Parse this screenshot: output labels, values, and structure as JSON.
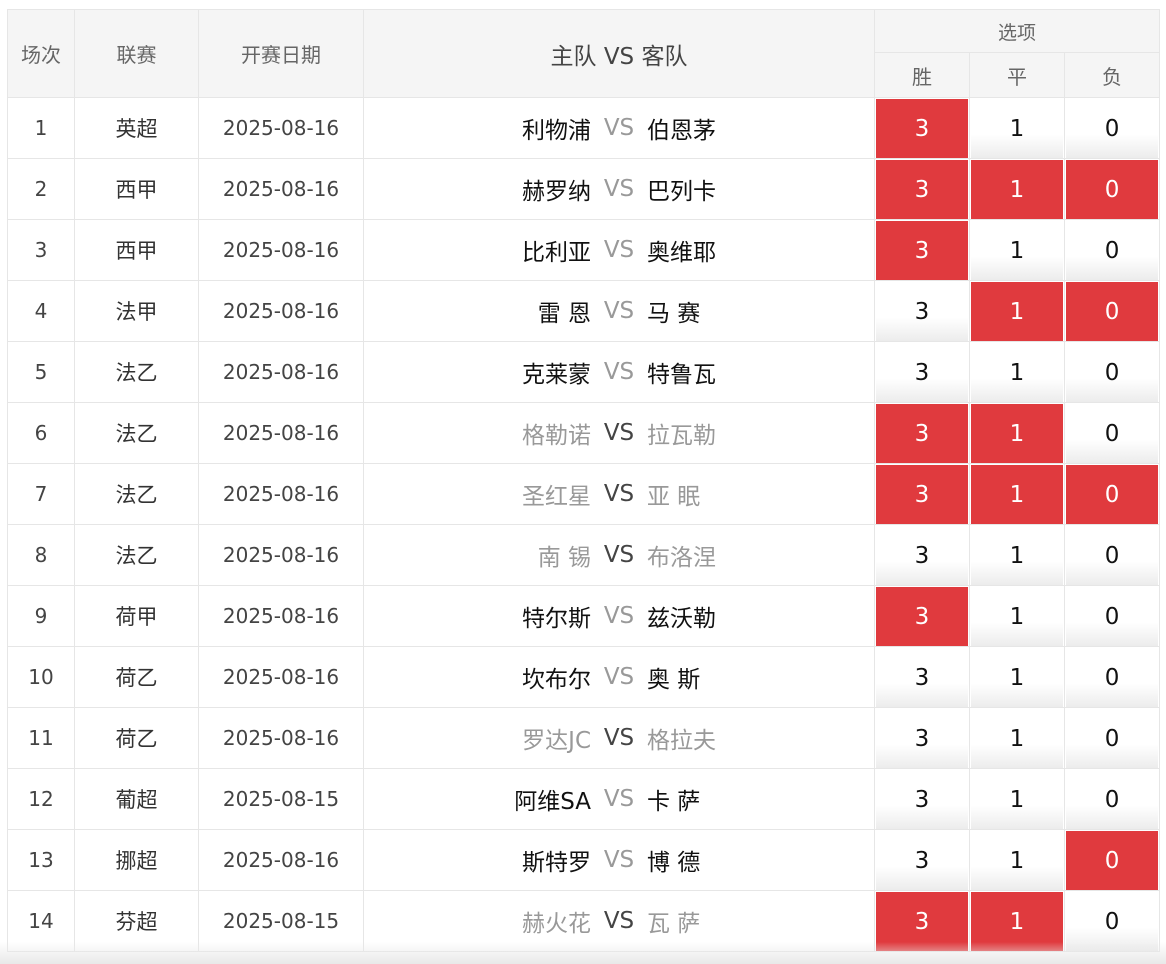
{
  "header": {
    "col_index": "场次",
    "col_league": "联赛",
    "col_date": "开赛日期",
    "col_match": "主队 VS 客队",
    "col_options": "选项",
    "opt_win": "胜",
    "opt_draw": "平",
    "opt_lose": "负"
  },
  "vs_label": "VS",
  "rows": [
    {
      "idx": "1",
      "league": "英超",
      "date": "2025-08-16",
      "home": "利物浦",
      "away": "伯恩茅",
      "grey": false,
      "w": "3",
      "d": "1",
      "l": "0",
      "sel": [
        true,
        false,
        false
      ]
    },
    {
      "idx": "2",
      "league": "西甲",
      "date": "2025-08-16",
      "home": "赫罗纳",
      "away": "巴列卡",
      "grey": false,
      "w": "3",
      "d": "1",
      "l": "0",
      "sel": [
        true,
        true,
        true
      ]
    },
    {
      "idx": "3",
      "league": "西甲",
      "date": "2025-08-16",
      "home": "比利亚",
      "away": "奥维耶",
      "grey": false,
      "w": "3",
      "d": "1",
      "l": "0",
      "sel": [
        true,
        false,
        false
      ]
    },
    {
      "idx": "4",
      "league": "法甲",
      "date": "2025-08-16",
      "home": "雷 恩",
      "away": "马 赛",
      "grey": false,
      "w": "3",
      "d": "1",
      "l": "0",
      "sel": [
        false,
        true,
        true
      ]
    },
    {
      "idx": "5",
      "league": "法乙",
      "date": "2025-08-16",
      "home": "克莱蒙",
      "away": "特鲁瓦",
      "grey": false,
      "w": "3",
      "d": "1",
      "l": "0",
      "sel": [
        false,
        false,
        false
      ]
    },
    {
      "idx": "6",
      "league": "法乙",
      "date": "2025-08-16",
      "home": "格勒诺",
      "away": "拉瓦勒",
      "grey": true,
      "w": "3",
      "d": "1",
      "l": "0",
      "sel": [
        true,
        true,
        false
      ]
    },
    {
      "idx": "7",
      "league": "法乙",
      "date": "2025-08-16",
      "home": "圣红星",
      "away": "亚 眠",
      "grey": true,
      "w": "3",
      "d": "1",
      "l": "0",
      "sel": [
        true,
        true,
        true
      ]
    },
    {
      "idx": "8",
      "league": "法乙",
      "date": "2025-08-16",
      "home": "南 锡",
      "away": "布洛涅",
      "grey": true,
      "w": "3",
      "d": "1",
      "l": "0",
      "sel": [
        false,
        false,
        false
      ]
    },
    {
      "idx": "9",
      "league": "荷甲",
      "date": "2025-08-16",
      "home": "特尔斯",
      "away": "兹沃勒",
      "grey": false,
      "w": "3",
      "d": "1",
      "l": "0",
      "sel": [
        true,
        false,
        false
      ]
    },
    {
      "idx": "10",
      "league": "荷乙",
      "date": "2025-08-16",
      "home": "坎布尔",
      "away": "奥 斯",
      "grey": false,
      "w": "3",
      "d": "1",
      "l": "0",
      "sel": [
        false,
        false,
        false
      ]
    },
    {
      "idx": "11",
      "league": "荷乙",
      "date": "2025-08-16",
      "home": "罗达JC",
      "away": "格拉夫",
      "grey": true,
      "w": "3",
      "d": "1",
      "l": "0",
      "sel": [
        false,
        false,
        false
      ]
    },
    {
      "idx": "12",
      "league": "葡超",
      "date": "2025-08-15",
      "home": "阿维SA",
      "away": "卡 萨",
      "grey": false,
      "w": "3",
      "d": "1",
      "l": "0",
      "sel": [
        false,
        false,
        false
      ]
    },
    {
      "idx": "13",
      "league": "挪超",
      "date": "2025-08-16",
      "home": "斯特罗",
      "away": "博 德",
      "grey": false,
      "w": "3",
      "d": "1",
      "l": "0",
      "sel": [
        false,
        false,
        true
      ]
    },
    {
      "idx": "14",
      "league": "芬超",
      "date": "2025-08-15",
      "home": "赫火花",
      "away": "瓦 萨",
      "grey": true,
      "w": "3",
      "d": "1",
      "l": "0",
      "sel": [
        true,
        true,
        false
      ]
    }
  ]
}
